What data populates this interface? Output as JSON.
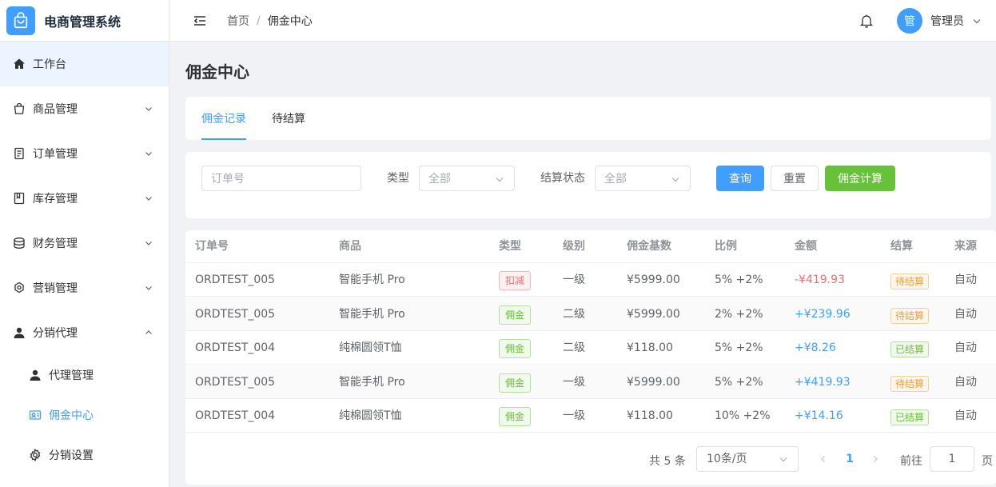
{
  "brand": {
    "title": "电商管理系统",
    "logo_icon": "shopping-bag-icon",
    "color": "#409eff"
  },
  "sidebar": {
    "items": [
      {
        "label": "工作台",
        "icon": "home-icon",
        "active": true
      },
      {
        "label": "商品管理",
        "icon": "bag-icon",
        "expandable": true
      },
      {
        "label": "订单管理",
        "icon": "document-icon",
        "expandable": true
      },
      {
        "label": "库存管理",
        "icon": "book-icon",
        "expandable": true
      },
      {
        "label": "财务管理",
        "icon": "coins-icon",
        "expandable": true
      },
      {
        "label": "营销管理",
        "icon": "megaphone-icon",
        "expandable": true
      },
      {
        "label": "分销代理",
        "icon": "user-icon",
        "expandable": true,
        "expanded": true
      }
    ],
    "sub_items": [
      {
        "label": "代理管理",
        "icon": "user-icon"
      },
      {
        "label": "佣金中心",
        "icon": "wallet-icon",
        "current": true
      },
      {
        "label": "分销设置",
        "icon": "gear-icon"
      }
    ]
  },
  "header": {
    "breadcrumb": {
      "home": "首页",
      "separator": "/",
      "current": "佣金中心"
    },
    "avatar_text": "管",
    "user_name": "管理员"
  },
  "page": {
    "title": "佣金中心"
  },
  "tabs": [
    {
      "label": "佣金记录",
      "active": true
    },
    {
      "label": "待结算"
    }
  ],
  "filters": {
    "order_placeholder": "订单号",
    "type_label": "类型",
    "type_value": "全部",
    "status_label": "结算状态",
    "status_value": "全部",
    "query_button": "查询",
    "reset_button": "重置",
    "calc_button": "佣金计算"
  },
  "table": {
    "columns": [
      "订单号",
      "商品",
      "类型",
      "级别",
      "佣金基数",
      "比例",
      "金额",
      "结算",
      "来源"
    ],
    "rows": [
      {
        "order": "ORDTEST_005",
        "product": "智能手机 Pro",
        "type": "扣减",
        "type_style": "danger",
        "level": "一级",
        "base": "¥5999.00",
        "ratio": "5% +2%",
        "amount": "-¥419.93",
        "amount_style": "neg",
        "settle": "待结算",
        "settle_style": "warning",
        "source": "自动"
      },
      {
        "order": "ORDTEST_005",
        "product": "智能手机 Pro",
        "type": "佣金",
        "type_style": "success",
        "level": "二级",
        "base": "¥5999.00",
        "ratio": "2% +2%",
        "amount": "+¥239.96",
        "amount_style": "pos",
        "settle": "待结算",
        "settle_style": "warning",
        "source": "自动"
      },
      {
        "order": "ORDTEST_004",
        "product": "纯棉圆领T恤",
        "type": "佣金",
        "type_style": "success",
        "level": "二级",
        "base": "¥118.00",
        "ratio": "5% +2%",
        "amount": "+¥8.26",
        "amount_style": "pos",
        "settle": "已结算",
        "settle_style": "success",
        "source": "自动"
      },
      {
        "order": "ORDTEST_005",
        "product": "智能手机 Pro",
        "type": "佣金",
        "type_style": "success",
        "level": "一级",
        "base": "¥5999.00",
        "ratio": "5% +2%",
        "amount": "+¥419.93",
        "amount_style": "pos",
        "settle": "待结算",
        "settle_style": "warning",
        "source": "自动"
      },
      {
        "order": "ORDTEST_004",
        "product": "纯棉圆领T恤",
        "type": "佣金",
        "type_style": "success",
        "level": "一级",
        "base": "¥118.00",
        "ratio": "10% +2%",
        "amount": "+¥14.16",
        "amount_style": "pos",
        "settle": "已结算",
        "settle_style": "success",
        "source": "自动"
      }
    ]
  },
  "pagination": {
    "total": "共 5 条",
    "page_size": "10条/页",
    "current_page": "1",
    "goto_label": "前往",
    "goto_value": "1",
    "page_suffix": "页"
  }
}
